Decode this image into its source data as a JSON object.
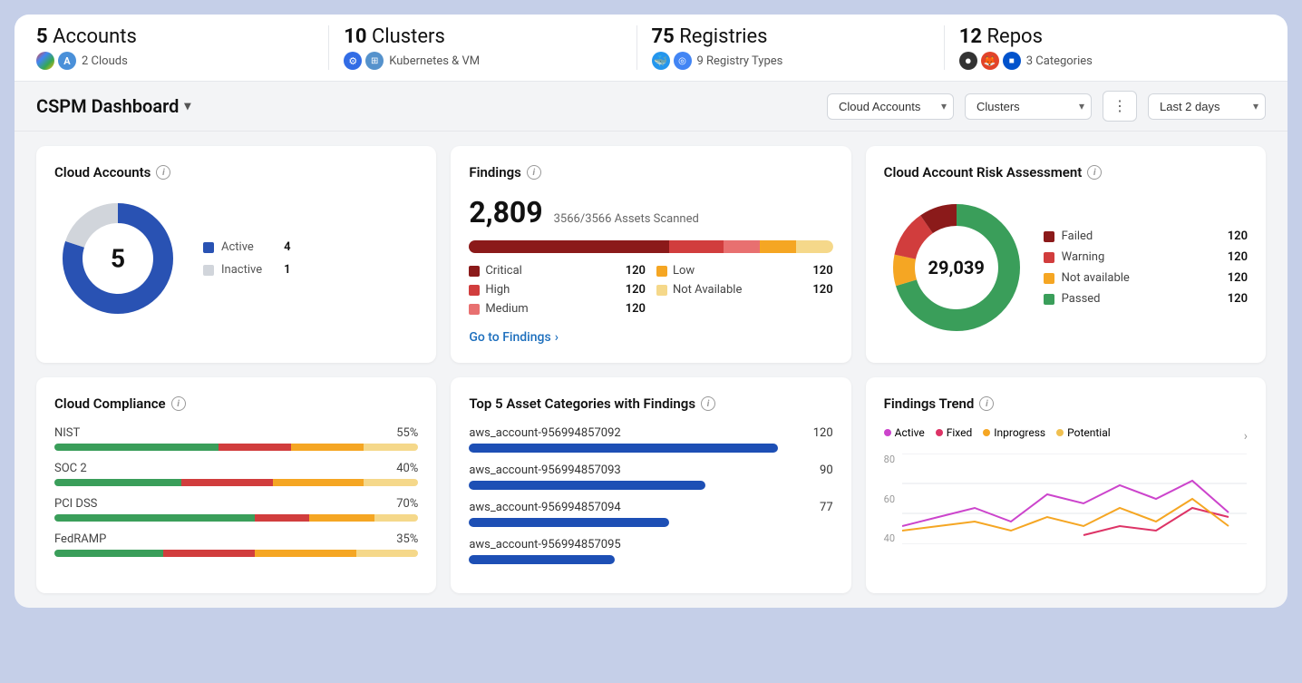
{
  "stats": [
    {
      "count": "5",
      "label": "Accounts",
      "sub": "2 Clouds",
      "icons": [
        "☁",
        "A"
      ]
    },
    {
      "count": "10",
      "label": "Clusters",
      "sub": "Kubernetes & VM",
      "icons": [
        "⚙",
        "⊞"
      ]
    },
    {
      "count": "75",
      "label": "Registries",
      "sub": "9 Registry Types",
      "icons": [
        "🐳",
        "⚙"
      ]
    },
    {
      "count": "12",
      "label": "Repos",
      "sub": "3 Categories",
      "icons": [
        "⬤",
        "🦊",
        "■"
      ]
    }
  ],
  "header": {
    "title": "CSPM Dashboard",
    "filters": {
      "cloud_accounts": "Cloud Accounts",
      "clusters": "Clusters",
      "time_range": "Last 2 days"
    }
  },
  "cloud_accounts": {
    "title": "Cloud Accounts",
    "total": "5",
    "active_count": 4,
    "inactive_count": 1,
    "active_label": "Active",
    "inactive_label": "Inactive"
  },
  "findings": {
    "title": "Findings",
    "total": "2,809",
    "assets_scanned": "3566/3566 Assets Scanned",
    "severities": [
      {
        "label": "Critical",
        "count": "120",
        "color": "#8b1a1a"
      },
      {
        "label": "High",
        "count": "120",
        "color": "#d13d3d"
      },
      {
        "label": "Medium",
        "count": "120",
        "color": "#e87070"
      },
      {
        "label": "Low",
        "count": "120",
        "color": "#f5a623"
      },
      {
        "label": "Not Available",
        "count": "120",
        "color": "#f5d88a"
      }
    ],
    "bar_segments": [
      {
        "color": "#8b1a1a",
        "width": "55%"
      },
      {
        "color": "#d13d3d",
        "width": "15%"
      },
      {
        "color": "#e87070",
        "width": "10%"
      },
      {
        "color": "#f5a623",
        "width": "10%"
      },
      {
        "color": "#f5d88a",
        "width": "10%"
      }
    ],
    "go_to_findings": "Go to Findings"
  },
  "risk_assessment": {
    "title": "Cloud Account Risk Assessment",
    "total": "29,039",
    "items": [
      {
        "label": "Failed",
        "count": "120",
        "color": "#8b1a1a"
      },
      {
        "label": "Warning",
        "count": "120",
        "color": "#d13d3d"
      },
      {
        "label": "Not available",
        "count": "120",
        "color": "#f5a623"
      },
      {
        "label": "Passed",
        "count": "120",
        "color": "#3a9e5a"
      }
    ]
  },
  "compliance": {
    "title": "Cloud Compliance",
    "items": [
      {
        "label": "NIST",
        "percentage": "55%",
        "segments": [
          {
            "color": "#3a9e5a",
            "width": "45%"
          },
          {
            "color": "#d13d3d",
            "width": "20%"
          },
          {
            "color": "#f5a623",
            "width": "20%"
          },
          {
            "color": "#f5d88a",
            "width": "15%"
          }
        ]
      },
      {
        "label": "SOC 2",
        "percentage": "40%",
        "segments": [
          {
            "color": "#3a9e5a",
            "width": "35%"
          },
          {
            "color": "#d13d3d",
            "width": "25%"
          },
          {
            "color": "#f5a623",
            "width": "25%"
          },
          {
            "color": "#f5d88a",
            "width": "15%"
          }
        ]
      },
      {
        "label": "PCI DSS",
        "percentage": "70%",
        "segments": [
          {
            "color": "#3a9e5a",
            "width": "55%"
          },
          {
            "color": "#d13d3d",
            "width": "15%"
          },
          {
            "color": "#f5a623",
            "width": "18%"
          },
          {
            "color": "#f5d88a",
            "width": "12%"
          }
        ]
      },
      {
        "label": "FedRAMP",
        "percentage": "35%",
        "segments": [
          {
            "color": "#3a9e5a",
            "width": "30%"
          },
          {
            "color": "#d13d3d",
            "width": "25%"
          },
          {
            "color": "#f5a623",
            "width": "28%"
          },
          {
            "color": "#f5d88a",
            "width": "17%"
          }
        ]
      }
    ]
  },
  "top5_assets": {
    "title": "Top 5 Asset Categories with Findings",
    "items": [
      {
        "label": "aws_account-956994857092",
        "count": "120",
        "bar_width": "85%"
      },
      {
        "label": "aws_account-956994857093",
        "count": "90",
        "bar_width": "65%"
      },
      {
        "label": "aws_account-956994857094",
        "count": "77",
        "bar_width": "55%"
      },
      {
        "label": "aws_account-956994857095",
        "count": "",
        "bar_width": "40%"
      }
    ]
  },
  "findings_trend": {
    "title": "Findings Trend",
    "legend": [
      {
        "label": "Active",
        "color": "#cc44cc"
      },
      {
        "label": "Fixed",
        "color": "#dd3366"
      },
      {
        "label": "Inprogress",
        "color": "#f5a623"
      },
      {
        "label": "Potential",
        "color": "#f0c050"
      }
    ],
    "y_labels": [
      "80",
      "60",
      "40"
    ]
  }
}
